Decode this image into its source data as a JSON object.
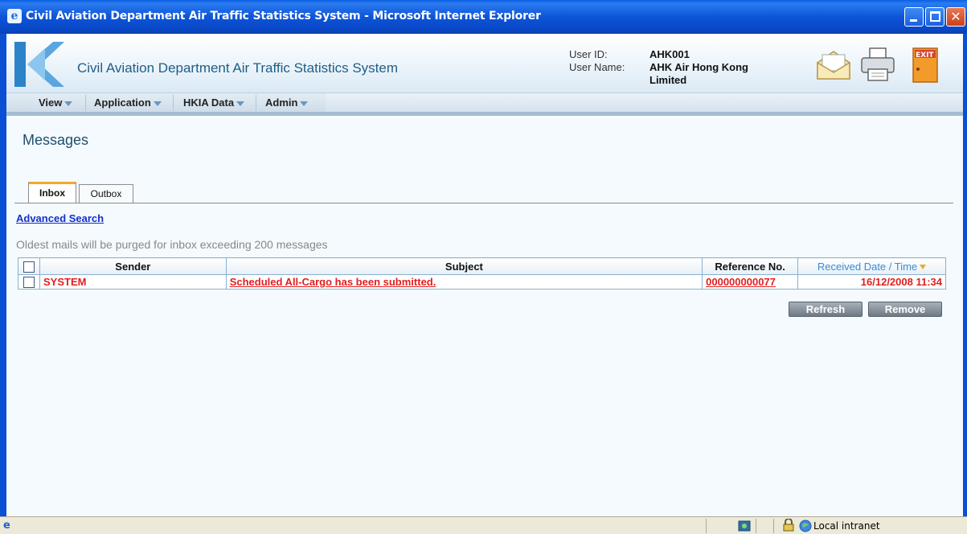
{
  "window": {
    "title": "Civil Aviation Department Air Traffic Statistics System - Microsoft Internet Explorer"
  },
  "header": {
    "app_title": "Civil Aviation Department Air Traffic Statistics System",
    "user_id_label": "User ID:",
    "user_name_label": "User Name:",
    "user_id": "AHK001",
    "user_name": "AHK Air Hong Kong Limited",
    "icons": [
      "mail-icon",
      "printer-icon",
      "exit-door-icon"
    ],
    "exit_text": "EXIT"
  },
  "menu": {
    "items": [
      {
        "label": "View"
      },
      {
        "label": "Application"
      },
      {
        "label": "HKIA Data"
      },
      {
        "label": "Admin"
      }
    ]
  },
  "page": {
    "title": "Messages",
    "tabs": [
      {
        "label": "Inbox",
        "active": true
      },
      {
        "label": "Outbox",
        "active": false
      }
    ],
    "advanced_search": "Advanced Search",
    "purge_note": "Oldest mails will be purged for inbox exceeding 200 messages"
  },
  "table": {
    "columns": [
      "Sender",
      "Subject",
      "Reference No.",
      "Received Date / Time"
    ],
    "rows": [
      {
        "sender": "SYSTEM",
        "subject": "Scheduled All-Cargo has been submitted.",
        "reference": "000000000077",
        "received": "16/12/2008 11:34"
      }
    ]
  },
  "buttons": {
    "refresh": "Refresh",
    "remove": "Remove"
  },
  "statusbar": {
    "zone": "Local intranet"
  },
  "colors": {
    "titlebar": "#0d55d8",
    "unread": "#e02020",
    "link": "#1430c8",
    "sorted_header": "#3d8bd6"
  }
}
